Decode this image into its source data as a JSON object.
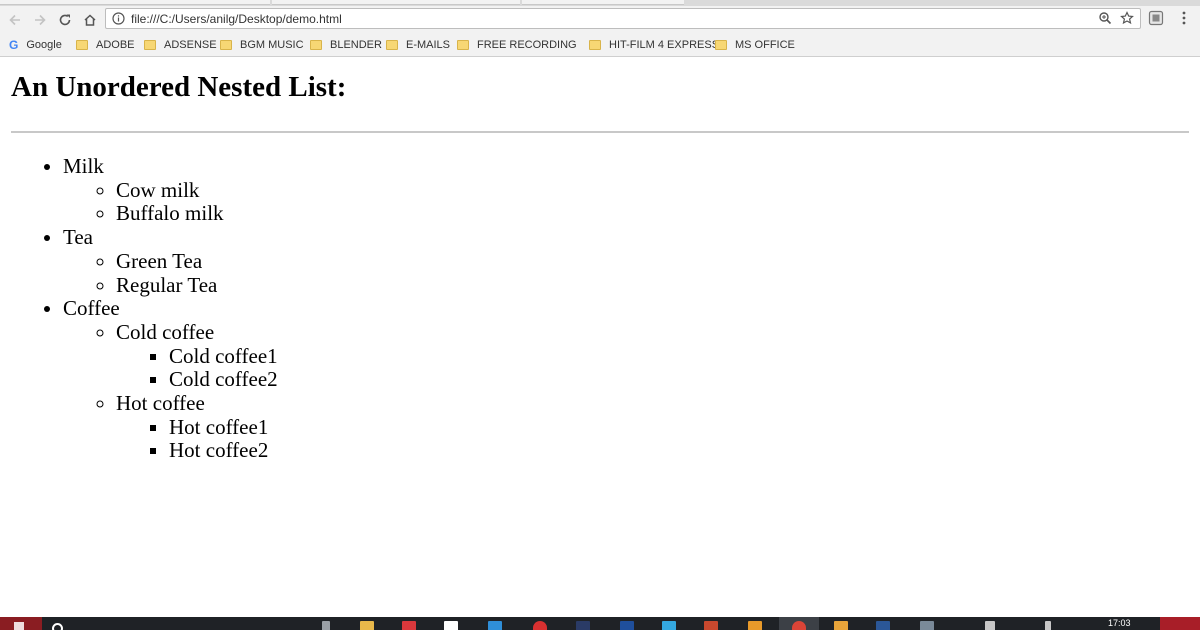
{
  "browser": {
    "url": "file:///C:/Users/anilg/Desktop/demo.html"
  },
  "bookmarks": [
    {
      "label": "Google",
      "icon": "google-icon"
    },
    {
      "label": "ADOBE",
      "icon": "folder-icon"
    },
    {
      "label": "ADSENSE",
      "icon": "folder-icon"
    },
    {
      "label": "BGM MUSIC",
      "icon": "folder-icon"
    },
    {
      "label": "BLENDER",
      "icon": "folder-icon"
    },
    {
      "label": "E-MAILS",
      "icon": "folder-icon"
    },
    {
      "label": "FREE RECORDING SO",
      "icon": "folder-icon"
    },
    {
      "label": "HIT-FILM 4 EXPRESS",
      "icon": "folder-icon"
    },
    {
      "label": "MS OFFICE",
      "icon": "folder-icon"
    }
  ],
  "page": {
    "title": "An Unordered Nested List:",
    "list": [
      {
        "label": "Milk",
        "children": [
          {
            "label": "Cow milk"
          },
          {
            "label": "Buffalo milk"
          }
        ]
      },
      {
        "label": "Tea",
        "children": [
          {
            "label": "Green Tea"
          },
          {
            "label": "Regular Tea"
          }
        ]
      },
      {
        "label": "Coffee",
        "children": [
          {
            "label": "Cold coffee",
            "children": [
              {
                "label": "Cold coffee1"
              },
              {
                "label": "Cold coffee2"
              }
            ]
          },
          {
            "label": "Hot coffee",
            "children": [
              {
                "label": "Hot coffee1"
              },
              {
                "label": "Hot coffee2"
              }
            ]
          }
        ]
      }
    ]
  },
  "taskbar": {
    "clock": "17:03",
    "colors": {
      "background": "#1f2226",
      "start": "#8a1d22"
    }
  }
}
